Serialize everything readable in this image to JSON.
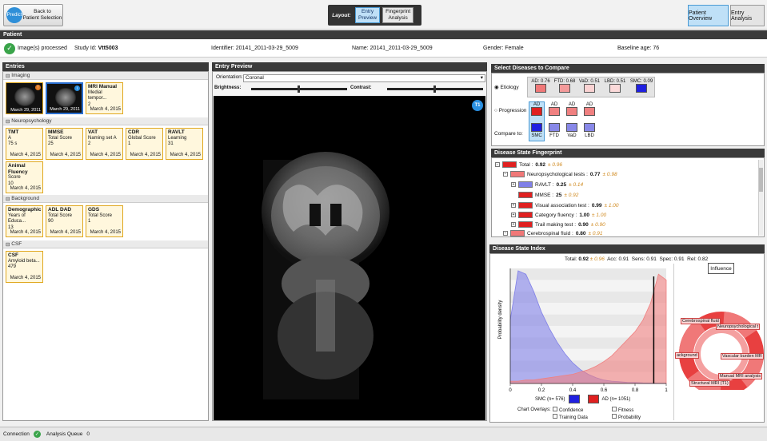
{
  "top": {
    "back_label_1": "Back to",
    "back_label_2": "Patient Selection",
    "logo_text": "Predict",
    "layout_label": "Layout:",
    "layout_btn1_1": "Entry",
    "layout_btn1_2": "Preview",
    "layout_btn2_1": "Fingerprint",
    "layout_btn2_2": "Analysis",
    "patient_overview": "Patient Overview",
    "entry_analysis": "Entry Analysis"
  },
  "patient": {
    "header": "Patient",
    "processed": "Image(s) processed",
    "study_label": "Study Id:",
    "study_value": "Vtt5003",
    "identifier_label": "Identifier:",
    "identifier_value": "20141_2011-03-29_5009",
    "name_label": "Name:",
    "name_value": "20141_2011-03-29_5009",
    "gender_label": "Gender:",
    "gender_value": "Female",
    "age_label": "Baseline age:",
    "age_value": "76"
  },
  "entries": {
    "header": "Entries",
    "imaging": "Imaging",
    "img1_date": "March 29, 2011",
    "img2_date": "March 29, 2011",
    "mri_title": "MRI Manual",
    "mri_sub": "Medial tempor...",
    "mri_val": "2",
    "mri_date": "March 4, 2015",
    "neuro": "Neuropsychology",
    "tiles": [
      {
        "t": "TMT",
        "s": "A",
        "v": "75 s",
        "d": "March 4, 2015"
      },
      {
        "t": "MMSE",
        "s": "Total Score",
        "v": "25",
        "d": "March 4, 2015"
      },
      {
        "t": "VAT",
        "s": "Naming set A",
        "v": "2",
        "d": "March 4, 2015"
      },
      {
        "t": "CDR",
        "s": "Global Score",
        "v": "1",
        "d": "March 4, 2015"
      },
      {
        "t": "RAVLT",
        "s": "Learning",
        "v": "31",
        "d": "March 4, 2015"
      },
      {
        "t": "Animal Fluency",
        "s": "Score",
        "v": "10",
        "d": "March 4, 2015"
      }
    ],
    "background": "Background",
    "bg_tiles": [
      {
        "t": "Demographic",
        "s": "Years of Educa...",
        "v": "13",
        "d": "March 4, 2015"
      },
      {
        "t": "ADL DAD",
        "s": "Total Score",
        "v": "90",
        "d": "March 4, 2015"
      },
      {
        "t": "GDS",
        "s": "Total Score",
        "v": "1",
        "d": "March 4, 2015"
      }
    ],
    "csf": "CSF",
    "csf_tile": {
      "t": "CSF",
      "s": "Amyloid beta...",
      "v": "479",
      "d": "March 4, 2015"
    }
  },
  "preview": {
    "header": "Entry Preview",
    "orientation_label": "Orientation:",
    "orientation_value": "Coronal",
    "brightness": "Brightness:",
    "contrast": "Contrast:",
    "t1": "T1"
  },
  "diseases": {
    "header": "Select Diseases to Compare",
    "etiology": "Etiology",
    "progression": "Progression",
    "compare_to": "Compare to:",
    "etiology_items": [
      {
        "label": "AD: 0.76",
        "color": "#f07878"
      },
      {
        "label": "FTD: 0.68",
        "color": "#f49a9a"
      },
      {
        "label": "VaD: 0.51",
        "color": "#fad2d2"
      },
      {
        "label": "LBD: 0.51",
        "color": "#fcdada"
      },
      {
        "label": "SMC: 0.09",
        "color": "#2020e0"
      }
    ],
    "prog_labels": [
      "AD",
      "AD",
      "AD",
      "AD"
    ],
    "compare_labels": [
      "SMC",
      "FTD",
      "VaD",
      "LBD"
    ]
  },
  "fingerprint": {
    "header": "Disease State Fingerprint",
    "rows": [
      {
        "label": "Total : ",
        "val": "0.92",
        "o": " ± 0.96",
        "color": "#e02020"
      },
      {
        "label": "Neuropsychological tests : ",
        "val": "0.77",
        "o": " ± 0.98 ",
        "color": "#f07878"
      },
      {
        "label": "RAVLT : ",
        "val": "0.25",
        "o": " ± 0.14 ",
        "color": "#8080e8"
      },
      {
        "label": "MMSE : ",
        "val": "25",
        "o": " ± 0.92 ",
        "color": "#e02020"
      },
      {
        "label": "Visual association test : ",
        "val": "0.99",
        "o": " ± 1.00 ",
        "color": "#e02020"
      },
      {
        "label": "Category fluency : ",
        "val": "1.00",
        "o": " ± 1.00 ",
        "color": "#e02020"
      },
      {
        "label": "Trail making test : ",
        "val": "0.90",
        "o": " ± 0.90 ",
        "color": "#e02020"
      },
      {
        "label": "Cerebrospinal fluid : ",
        "val": "0.80",
        "o": " ± 0.91 ",
        "color": "#f07878"
      }
    ]
  },
  "dsi": {
    "header": "Disease State Index",
    "stats_total": "Total: ",
    "stats_total_val": "0.92",
    "stats_total_o": " ± 0.96",
    "stats_rest": "  Acc: 0.91  Sens: 0.91  Spec: 0.91  Rel: 0.82",
    "influence": "Influence",
    "ylabel": "Probability density",
    "ticks": [
      "0",
      "0.2",
      "0.4",
      "0.6",
      "0.8",
      "1"
    ],
    "legend_smc": "SMC (n= 576)",
    "legend_ad": "AD (n= 1051)",
    "overlays_label": "Chart Overlays:",
    "overlays": [
      "Confidence",
      "Fitness",
      "Training Data",
      "Probability"
    ],
    "ring_labels": [
      "Cerebrospinal fluid",
      "Neuropsychological t",
      "ackground",
      "Vascular burden MR",
      "Manual MRI analysis",
      "Structural MRI (T1)"
    ]
  },
  "status": {
    "connection": "Connection",
    "queue": "Analysis Queue",
    "queue_val": "0"
  },
  "chart_data": {
    "type": "area",
    "ylabel": "Probability density",
    "xlim": [
      0,
      1
    ],
    "x": [
      0,
      0.05,
      0.1,
      0.15,
      0.2,
      0.25,
      0.3,
      0.35,
      0.4,
      0.45,
      0.5,
      0.55,
      0.6,
      0.65,
      0.7,
      0.75,
      0.8,
      0.85,
      0.9,
      0.95,
      1.0
    ],
    "series": [
      {
        "name": "SMC (n= 576)",
        "color": "#8080e8",
        "values": [
          0.55,
          0.98,
          0.95,
          0.8,
          0.62,
          0.48,
          0.36,
          0.26,
          0.18,
          0.12,
          0.08,
          0.05,
          0.03,
          0.02,
          0.015,
          0.01,
          0.008,
          0.005,
          0.004,
          0.003,
          0.002
        ]
      },
      {
        "name": "AD (n= 1051)",
        "color": "#f08080",
        "values": [
          0.02,
          0.02,
          0.03,
          0.03,
          0.04,
          0.05,
          0.06,
          0.07,
          0.08,
          0.1,
          0.12,
          0.15,
          0.19,
          0.24,
          0.31,
          0.38,
          0.45,
          0.55,
          0.7,
          0.95,
          0.9
        ]
      }
    ],
    "marker_x": 0.92
  }
}
